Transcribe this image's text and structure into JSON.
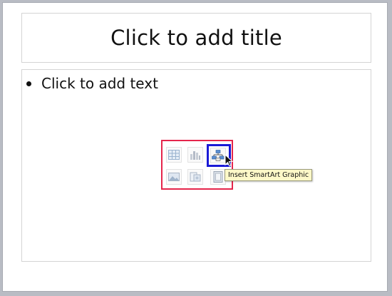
{
  "slide": {
    "title_placeholder": "Click to add title",
    "content_placeholder": {
      "bullet_text": "Click to add text"
    }
  },
  "insert_icons": [
    {
      "name": "insert-table-icon"
    },
    {
      "name": "insert-chart-icon"
    },
    {
      "name": "insert-smartart-icon"
    },
    {
      "name": "insert-picture-icon"
    },
    {
      "name": "insert-clip-art-icon"
    },
    {
      "name": "insert-media-icon"
    }
  ],
  "tooltip": {
    "text": "Insert SmartArt Graphic"
  },
  "colors": {
    "panel_outline": "#e5254b",
    "highlight_outline": "#1a1ad6",
    "tooltip_background": "#fdf8c8"
  }
}
